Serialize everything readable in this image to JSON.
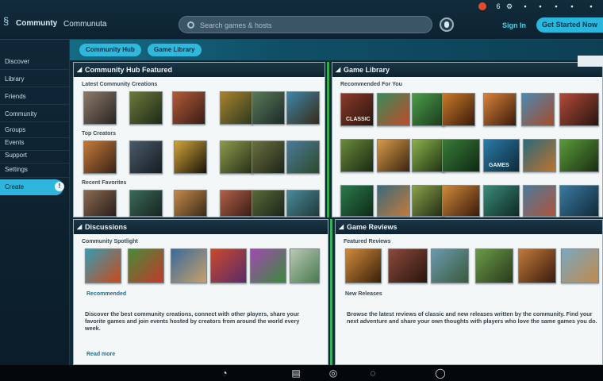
{
  "app": {
    "brand": "Communty",
    "brand_secondary": "Communuta"
  },
  "search": {
    "placeholder": "Search games & hosts"
  },
  "topbar": {
    "cta_left": "Sign In",
    "cta_button": "Get Started Now"
  },
  "sidebar": {
    "items": [
      {
        "label": "Discover"
      },
      {
        "label": "Library"
      },
      {
        "label": "Friends"
      },
      {
        "label": "Community"
      },
      {
        "label": "Groups"
      },
      {
        "label": "Events"
      },
      {
        "label": "Support"
      },
      {
        "label": "Settings"
      }
    ],
    "active": {
      "label": "Create",
      "badge": "!"
    }
  },
  "banner": {
    "pill_left": "Community Hub",
    "pill_mid": "Game Library"
  },
  "panels": {
    "top_left": {
      "title": "Community Hub Featured",
      "sub1": "Latest Community Creations",
      "sub2": "Top Creators",
      "sub3": "Recent Favorites"
    },
    "top_right": {
      "title": "Game Library",
      "sub1": "Recommended For You",
      "tile_labels": [
        "CLASSIC",
        "GAMES"
      ]
    },
    "bottom_left": {
      "title": "Discussions",
      "sub": "Community Spotlight",
      "caption": "Recommended",
      "text": "Discover the best community creations, connect with other players, share your favorite games and join events hosted by creators from around the world every week.",
      "link": "Read more"
    },
    "bottom_right": {
      "title": "Game Reviews",
      "sub": "Featured Reviews",
      "caption": "New Releases",
      "text": "Browse the latest reviews of classic and new releases written by the community. Find your next adventure and share your own thoughts with players who love the same games you do."
    }
  },
  "colors": {
    "accent": "#2fb7dc",
    "background": "#0b1e2c",
    "panel": "#f4f7f8",
    "green": "#2fae4a"
  },
  "icons": [
    "search-icon",
    "mic-icon",
    "chrome-icon",
    "notification-icon",
    "chevron-icon",
    "bell-icon",
    "close-icon"
  ]
}
